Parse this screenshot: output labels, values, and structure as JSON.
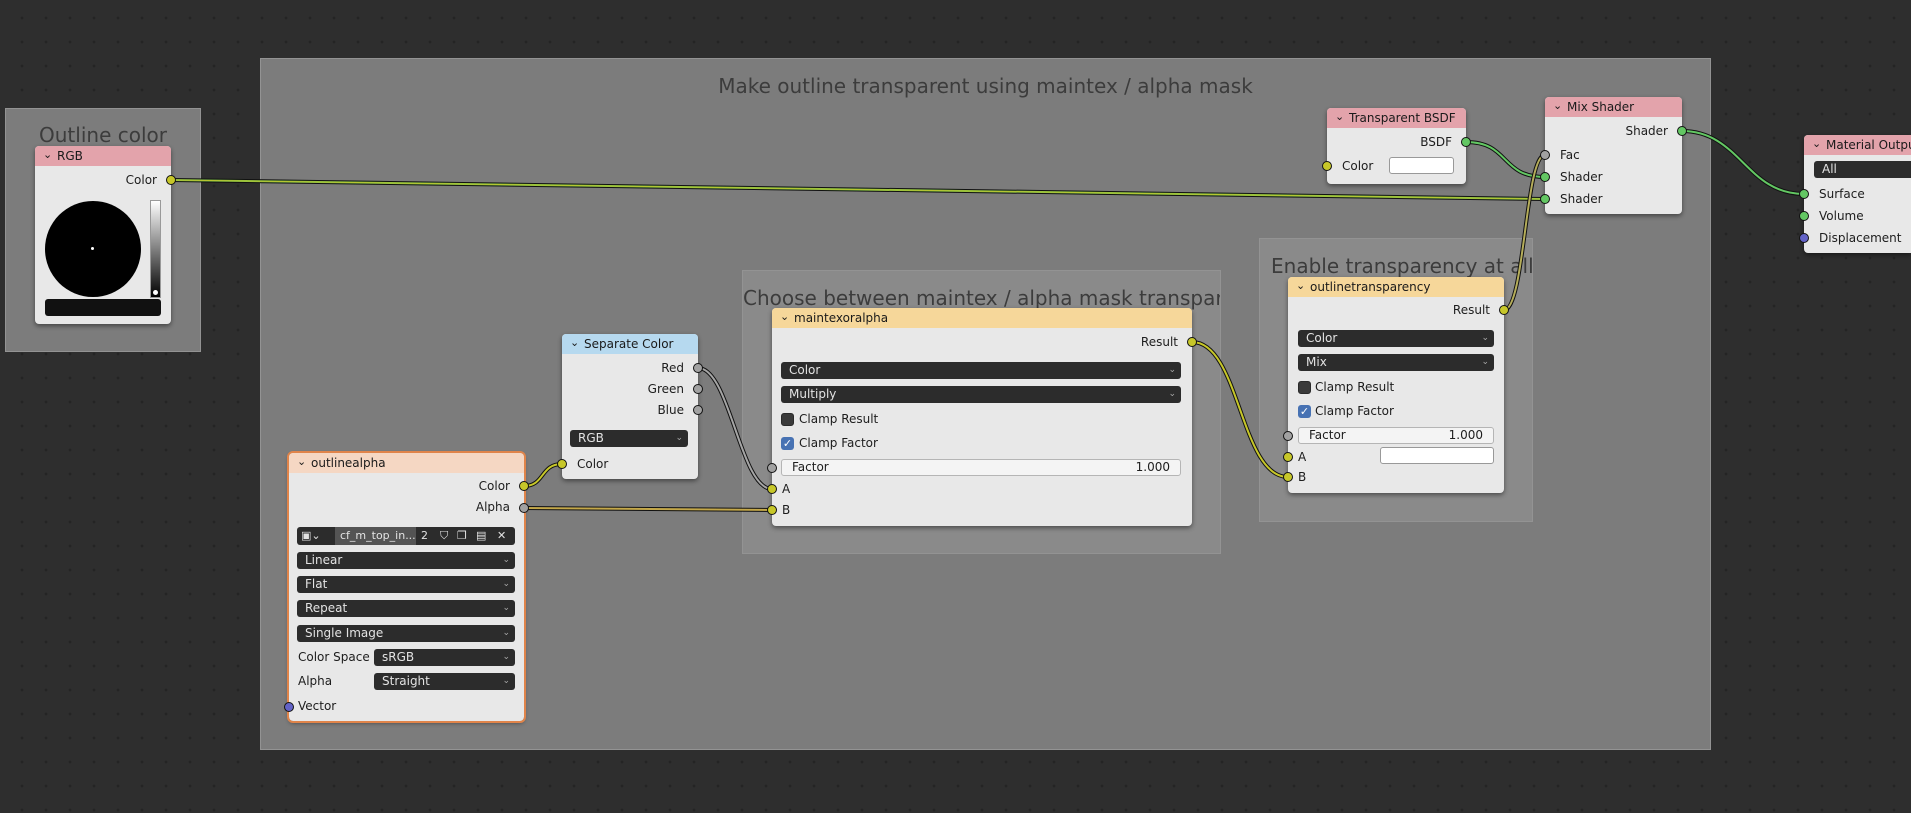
{
  "frames": {
    "outline_color": "Outline color",
    "make_outline": "Make outline transparent using maintex / alpha mask",
    "choose_between": "Choose between maintex / alpha mask transparency",
    "enable_transparency": "Enable transparency at all"
  },
  "rgb_node": {
    "title": "RGB",
    "output_color": "Color"
  },
  "transparent_bsdf": {
    "title": "Transparent BSDF",
    "output": "BSDF",
    "input_color": "Color"
  },
  "mix_shader": {
    "title": "Mix Shader",
    "output": "Shader",
    "input_fac": "Fac",
    "input_shader1": "Shader",
    "input_shader2": "Shader"
  },
  "material_output": {
    "title": "Material Output",
    "target": "All",
    "surface": "Surface",
    "volume": "Volume",
    "displacement": "Displacement"
  },
  "separate_color": {
    "title": "Separate Color",
    "red": "Red",
    "green": "Green",
    "blue": "Blue",
    "mode": "RGB",
    "input_color": "Color"
  },
  "outlinealpha": {
    "title": "outlinealpha",
    "output_color": "Color",
    "output_alpha": "Alpha",
    "image_name": "cf_m_top_in...",
    "user_count": "2",
    "interpolation": "Linear",
    "projection": "Flat",
    "extension": "Repeat",
    "source": "Single Image",
    "color_space_label": "Color Space",
    "color_space": "sRGB",
    "alpha_label": "Alpha",
    "alpha_mode": "Straight",
    "input_vector": "Vector"
  },
  "maintexoralpha": {
    "title": "maintexoralpha",
    "output": "Result",
    "data_type": "Color",
    "blend_mode": "Multiply",
    "clamp_result": "Clamp Result",
    "clamp_factor": "Clamp Factor",
    "factor_label": "Factor",
    "factor_value": "1.000",
    "input_a": "A",
    "input_b": "B"
  },
  "outlinetransparency": {
    "title": "outlinetransparency",
    "output": "Result",
    "data_type": "Color",
    "blend_mode": "Mix",
    "clamp_result": "Clamp Result",
    "clamp_factor": "Clamp Factor",
    "factor_label": "Factor",
    "factor_value": "1.000",
    "input_a": "A",
    "input_b": "B"
  },
  "colors": {
    "header_shader": "#e3a3ab",
    "header_input": "#f5d7c3",
    "header_converter": "#b6d9ef",
    "header_group": "#f6d79a",
    "socket_color": "#c7c729",
    "socket_shader": "#63c763",
    "socket_float": "#a1a1a1",
    "socket_vector": "#6363c7",
    "frame_bg": "#7c7c7c",
    "canvas_bg": "#2e2e2e"
  }
}
